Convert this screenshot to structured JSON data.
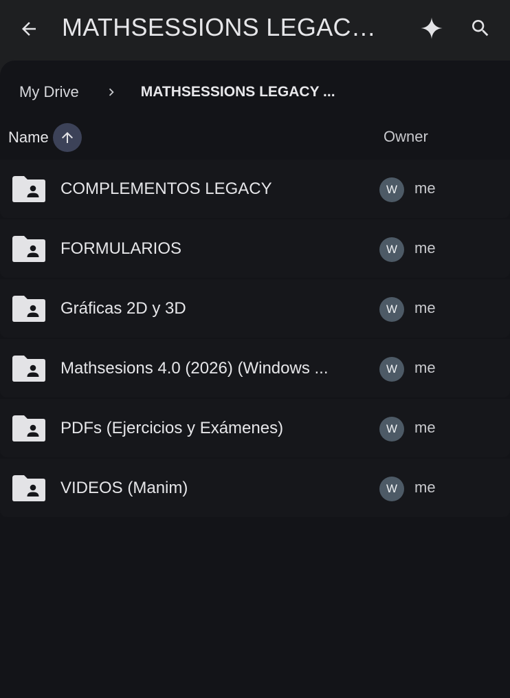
{
  "header": {
    "title": "MATHSESSIONS LEGACY...",
    "back_icon": "arrow-back-icon",
    "sparkle_icon": "sparkle-icon",
    "search_icon": "search-icon"
  },
  "breadcrumb": {
    "root": "My Drive",
    "separator_icon": "chevron-right-icon",
    "current": "MATHSESSIONS LEGACY ..."
  },
  "columns": {
    "name": "Name",
    "sort_icon": "arrow-up-icon",
    "owner": "Owner"
  },
  "files": [
    {
      "name": "COMPLEMENTOS LEGACY",
      "icon": "shared-folder-icon",
      "owner_initial": "W",
      "owner": "me"
    },
    {
      "name": "FORMULARIOS",
      "icon": "shared-folder-icon",
      "owner_initial": "W",
      "owner": "me"
    },
    {
      "name": "Gráficas 2D y 3D",
      "icon": "shared-folder-icon",
      "owner_initial": "W",
      "owner": "me"
    },
    {
      "name": "Mathsesions 4.0 (2026) (Windows ...",
      "icon": "shared-folder-icon",
      "owner_initial": "W",
      "owner": "me"
    },
    {
      "name": "PDFs (Ejercicios y Exámenes)",
      "icon": "shared-folder-icon",
      "owner_initial": "W",
      "owner": "me"
    },
    {
      "name": "VIDEOS (Manim)",
      "icon": "shared-folder-icon",
      "owner_initial": "W",
      "owner": "me"
    }
  ],
  "colors": {
    "background": "#1e1f21",
    "panel": "#131418",
    "row": "#16171b",
    "sort_chip": "#3c4258",
    "avatar": "#4d5a66",
    "icon": "#e3e3e6"
  }
}
